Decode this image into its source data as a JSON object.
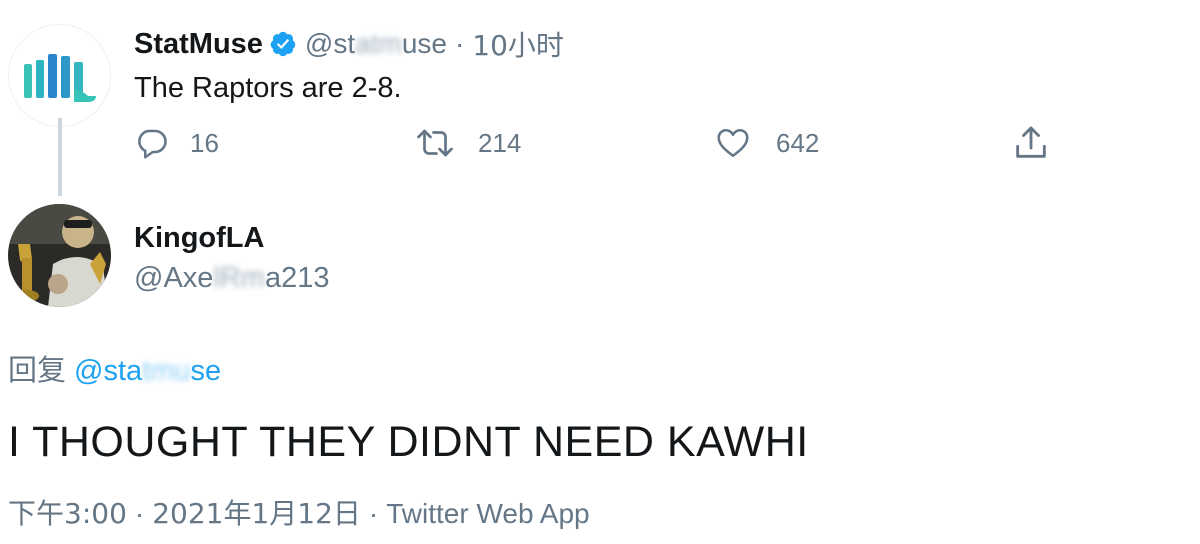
{
  "parent_tweet": {
    "display_name": "StatMuse",
    "handle_visible_start": "@st",
    "handle_blurred": "atm",
    "handle_visible_end": "use",
    "separator": "·",
    "time_ago": "10小时",
    "text": "The Raptors are 2-8.",
    "verified": true,
    "avatar_icon": "statmuse-logo-icon",
    "actions": {
      "reply_count": "16",
      "retweet_count": "214",
      "like_count": "642"
    }
  },
  "reply_tweet": {
    "display_name": "KingofLA",
    "handle_visible_start": "@Axe",
    "handle_blurred": "lRm",
    "handle_visible_end": "a213",
    "avatar_icon": "user-avatar-photo",
    "replying_prefix": "回复",
    "replying_mention_start": "@sta",
    "replying_mention_blurred": "tmu",
    "replying_mention_end": "se",
    "text": "I THOUGHT THEY DIDNT NEED KAWHI",
    "time": "下午3:00",
    "separator": "·",
    "date": "2021年1月12日",
    "source": "Twitter Web App"
  },
  "colors": {
    "text_primary": "#14171a",
    "text_secondary": "#657786",
    "link_blue": "#1da1f2",
    "verified_blue": "#1da1f2",
    "thread_line": "#ccd6dd",
    "logo_teal": "#2bb3c6"
  }
}
